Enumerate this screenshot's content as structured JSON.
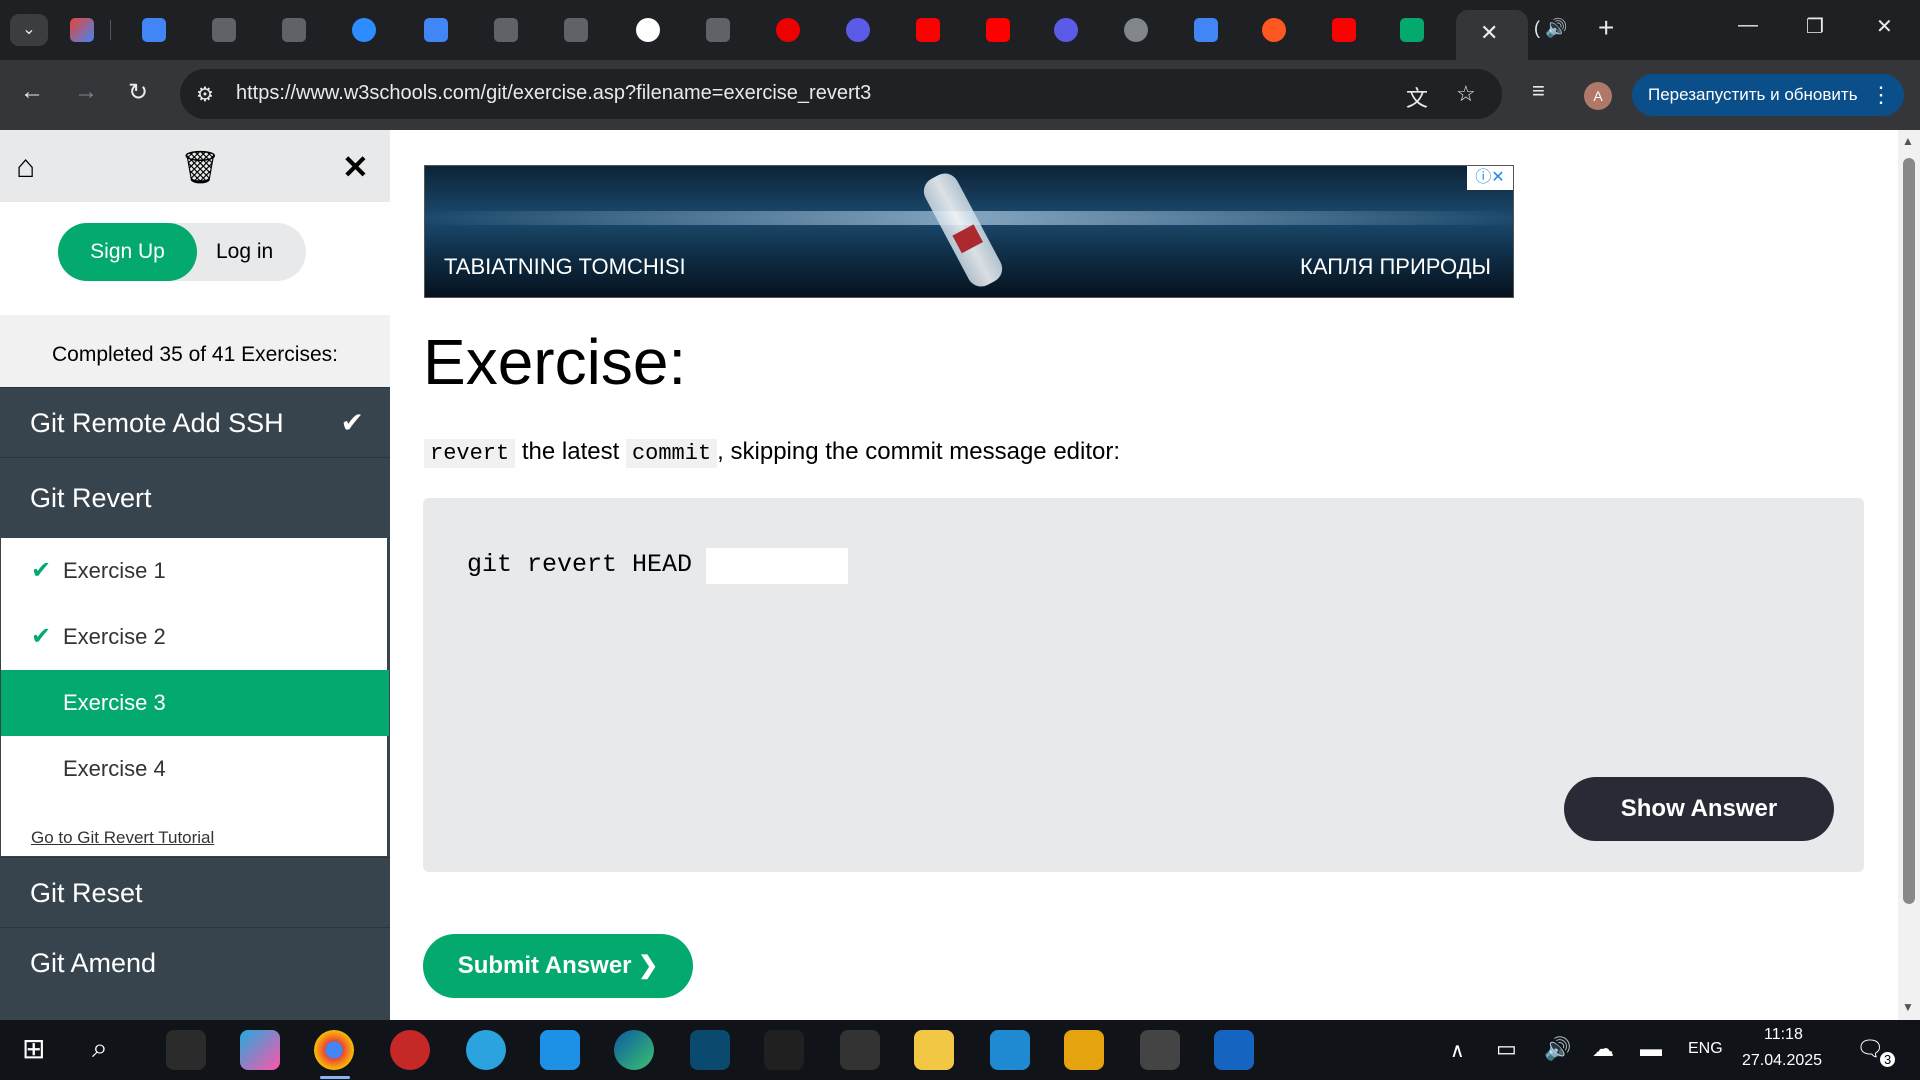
{
  "browser": {
    "url": "https://www.w3schools.com/git/exercise.asp?filename=exercise_revert3",
    "relaunch_label": "Перезапустить и обновить",
    "profile_initial": "A",
    "audio_tab_prefix": "("
  },
  "sidebar": {
    "signup_label": "Sign Up",
    "login_label": "Log in",
    "completed_text": "Completed 35 of 41 Exercises:",
    "sections": [
      {
        "label": "Git Remote Add SSH",
        "completed": true
      },
      {
        "label": "Git Revert"
      },
      {
        "label": "Git Reset"
      },
      {
        "label": "Git Amend"
      }
    ],
    "exercises": [
      {
        "label": "Exercise 1",
        "completed": true
      },
      {
        "label": "Exercise 2",
        "completed": true
      },
      {
        "label": "Exercise 3",
        "active": true
      },
      {
        "label": "Exercise 4"
      }
    ],
    "tutorial_link": "Go to Git Revert Tutorial"
  },
  "ad": {
    "left_text": "TABIATNING TOMCHISI",
    "right_text": "КАПЛЯ ПРИРОДЫ"
  },
  "exercise": {
    "heading": "Exercise:",
    "instruction_code1": "revert",
    "instruction_text1": " the latest ",
    "instruction_code2": "commit",
    "instruction_text2": ", skipping the commit message editor:",
    "command_prefix": "git revert HEAD",
    "answer_value": "",
    "show_answer_label": "Show Answer",
    "submit_label": "Submit Answer ❯"
  },
  "taskbar": {
    "language": "ENG",
    "time": "11:18",
    "date": "27.04.2025",
    "notification_count": "3"
  },
  "colors": {
    "w3_green": "#04aa6d",
    "sidebar_dark": "#38444d",
    "button_dark": "#282a35"
  }
}
